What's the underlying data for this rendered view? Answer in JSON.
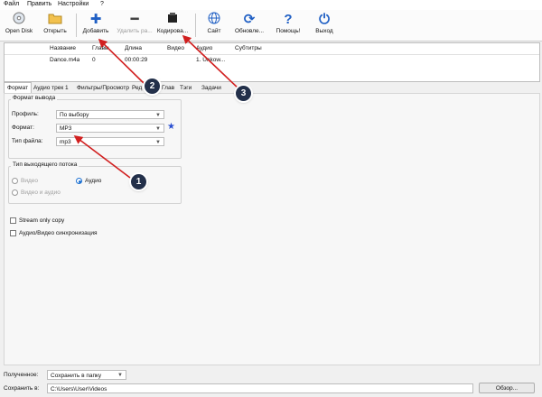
{
  "menu": [
    "Файл",
    "Править",
    "Настройки",
    "?"
  ],
  "toolbar": {
    "open_disk": "Open Disk",
    "open": "Открыть",
    "add": "Добавить",
    "remove": "Удалить ра...",
    "encode": "Кодирова...",
    "site": "Сайт",
    "update": "Обновле...",
    "help": "Помощь!",
    "exit": "Выход"
  },
  "filelist": {
    "headers": [
      "Название",
      "Главы",
      "Длина",
      "Видео",
      "Аудио",
      "Субтитры"
    ],
    "rows": [
      [
        "Dance.m4a",
        "0",
        "00:00:29",
        "",
        "1. Unkow...",
        ""
      ]
    ]
  },
  "tabs": [
    "Формат",
    "Аудио трек 1",
    "Фильтры/Просмотр",
    "Ред",
    "Глав",
    "Тэги",
    "Задачи"
  ],
  "format": {
    "group_title": "Формат вывода",
    "profile_label": "Профиль:",
    "profile_value": "По выбору",
    "format_label": "Формат:",
    "format_value": "MP3",
    "filetype_label": "Тип файла:",
    "filetype_value": "mp3"
  },
  "stream": {
    "group_title": "Тип выходящего потока",
    "video": "Видео",
    "audio": "Аудио",
    "video_audio": "Видео и аудио",
    "selected": "audio"
  },
  "options": {
    "stream_only_copy": "Stream only copy",
    "av_sync": "Аудио/Видео синхронизация"
  },
  "bottom": {
    "received_label": "Полученное:",
    "received_value": "Сохранить в папку",
    "save_label": "Сохранить в:",
    "save_path": "C:\\Users\\User\\Videos",
    "browse": "Обзор..."
  },
  "annotations": [
    "1",
    "2",
    "3"
  ],
  "colors": {
    "arrow": "#d11f1f",
    "badge": "#23304a",
    "accent": "#1a6fd1"
  }
}
